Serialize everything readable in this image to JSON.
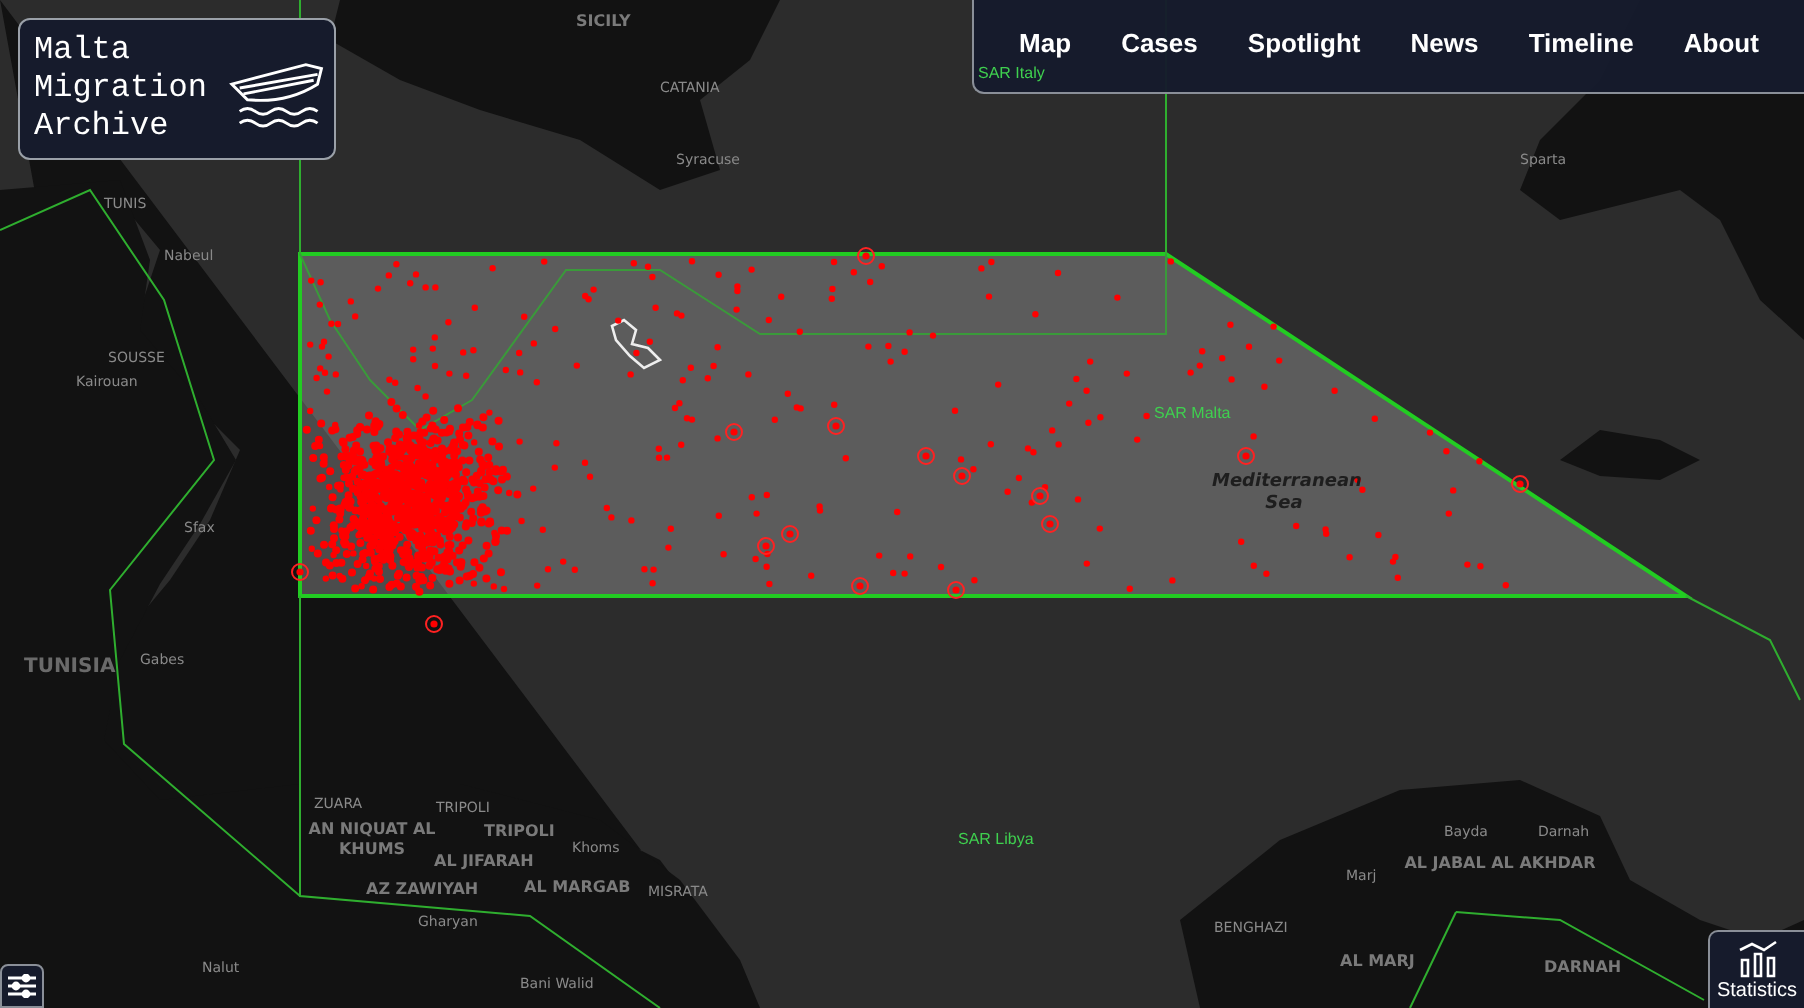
{
  "logo": {
    "title": "Malta Migration Archive"
  },
  "nav": {
    "items": [
      {
        "label": "Map"
      },
      {
        "label": "Cases"
      },
      {
        "label": "Spotlight"
      },
      {
        "label": "News"
      },
      {
        "label": "Timeline"
      },
      {
        "label": "About"
      }
    ]
  },
  "map": {
    "labels": [
      {
        "text": "SICILY",
        "kind": "region"
      },
      {
        "text": "CATANIA",
        "kind": "city"
      },
      {
        "text": "Syracuse",
        "kind": "city"
      },
      {
        "text": "SAR Italy",
        "kind": "sar"
      },
      {
        "text": "Sparta",
        "kind": "city"
      },
      {
        "text": "TUNIS",
        "kind": "city"
      },
      {
        "text": "Nabeul",
        "kind": "city"
      },
      {
        "text": "SOUSSE",
        "kind": "city"
      },
      {
        "text": "Kairouan",
        "kind": "city"
      },
      {
        "text": "Sfax",
        "kind": "city"
      },
      {
        "text": "TUNISIA",
        "kind": "country"
      },
      {
        "text": "Gabes",
        "kind": "city"
      },
      {
        "text": "SAR Malta",
        "kind": "sar"
      },
      {
        "text": "Mediterranean Sea",
        "kind": "sea"
      },
      {
        "text": "ZUARA",
        "kind": "city"
      },
      {
        "text": "AN NIQUAT AL KHUMS",
        "kind": "region"
      },
      {
        "text": "TRIPOLI",
        "kind": "city"
      },
      {
        "text": "TRIPOLI",
        "kind": "region"
      },
      {
        "text": "AL JIFARAH",
        "kind": "region"
      },
      {
        "text": "Khoms",
        "kind": "city"
      },
      {
        "text": "AZ ZAWIYAH",
        "kind": "region"
      },
      {
        "text": "AL MARGAB",
        "kind": "region"
      },
      {
        "text": "MISRATA",
        "kind": "city"
      },
      {
        "text": "Gharyan",
        "kind": "city"
      },
      {
        "text": "Nalut",
        "kind": "city"
      },
      {
        "text": "Bani Walid",
        "kind": "city"
      },
      {
        "text": "SAR Libya",
        "kind": "sar"
      },
      {
        "text": "Bayda",
        "kind": "city"
      },
      {
        "text": "Darnah",
        "kind": "city"
      },
      {
        "text": "AL JABAL AL AKHDAR",
        "kind": "region"
      },
      {
        "text": "Marj",
        "kind": "city"
      },
      {
        "text": "BENGHAZI",
        "kind": "city"
      },
      {
        "text": "AL MARJ",
        "kind": "region"
      },
      {
        "text": "DARNAH",
        "kind": "region"
      }
    ]
  },
  "statistics_button": {
    "label": "Statistics"
  }
}
